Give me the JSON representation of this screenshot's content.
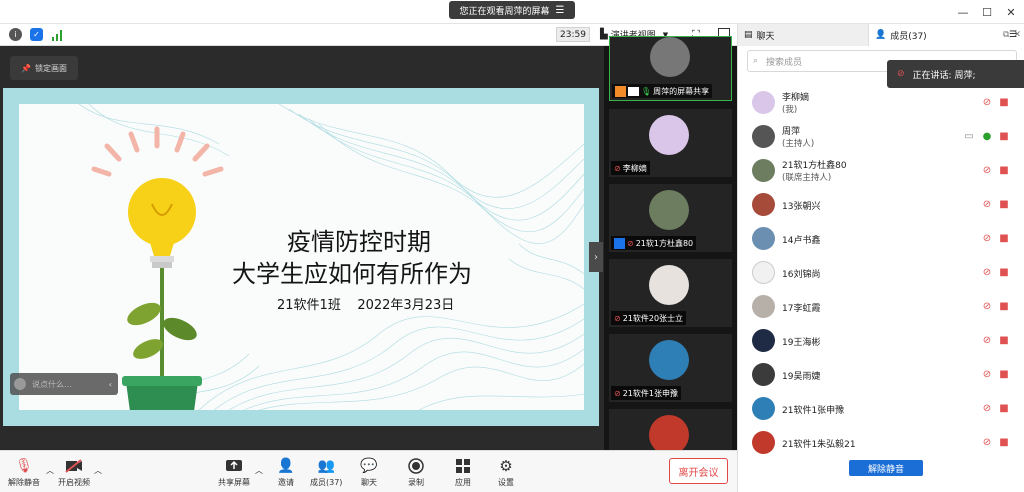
{
  "titlebar": {
    "viewing_banner": "您正在观看周萍的屏幕",
    "menu_icon": "hamburger-icon",
    "window_controls": [
      "minimize-icon",
      "maximize-icon",
      "close-icon"
    ]
  },
  "meetbar": {
    "timer": "23:59",
    "view_mode_label": "演讲者视图",
    "icons": [
      "info-icon",
      "shield-icon",
      "signal-icon",
      "fullscreen-icon",
      "sidebar-icon"
    ],
    "colors": {
      "info": "#555555",
      "shield": "#1a73e8",
      "signal": "#2ca02c"
    }
  },
  "stage": {
    "lock_label": "锁定画面",
    "slide": {
      "title_line1": "疫情防控时期",
      "title_line2": "大学生应如何有所作为",
      "meta": "21软件1班    2022年3月23日",
      "frame_color": "#a9dde1"
    },
    "comment_placeholder": "说点什么..."
  },
  "strip": {
    "tiles": [
      {
        "label": "周萍的屏幕共享",
        "avatar_color": "#777777",
        "active": true
      },
      {
        "label": "李柳嫡",
        "avatar_color": "#d9c6e9"
      },
      {
        "label": "21软1方杜鑫80",
        "avatar_color": "#6d7d5f"
      },
      {
        "label": "21软件20张士立",
        "avatar_color": "#e8e2de"
      },
      {
        "label": "21软件1张申豫",
        "avatar_color": "#2f7fb7"
      },
      {
        "label": "",
        "avatar_color": "#c0392b"
      }
    ]
  },
  "bottombar": {
    "unmute_label": "解除静音",
    "video_label": "开启视频",
    "share_label": "共享屏幕",
    "invite_label": "邀请",
    "members_label": "成员(37)",
    "chat_label": "聊天",
    "record_label": "录制",
    "apps_label": "应用",
    "settings_label": "设置",
    "leave_label": "离开会议"
  },
  "panel": {
    "chat_tab": "聊天",
    "members_tab": "成员(37)",
    "search_placeholder": "搜索成员",
    "speaking_prefix": "正在讲话: 周萍;",
    "unmute_all": "解除静音",
    "members": [
      {
        "name": "李柳嫡",
        "sub": "(我)",
        "avatar_color": "#d9c6e9"
      },
      {
        "name": "周萍",
        "sub": "(主持人)",
        "avatar_color": "#555555",
        "host": true
      },
      {
        "name": "21软1方杜鑫80",
        "sub": "(联席主持人)",
        "avatar_color": "#6d7d5f"
      },
      {
        "name": "13张朝兴",
        "sub": "",
        "avatar_color": "#a64a3a"
      },
      {
        "name": "14卢书鑫",
        "sub": "",
        "avatar_color": "#6a8fb0"
      },
      {
        "name": "16刘锦尚",
        "sub": "",
        "avatar_color": "#f1f1f1"
      },
      {
        "name": "17李虹霞",
        "sub": "",
        "avatar_color": "#b7b0a8"
      },
      {
        "name": "19王海彬",
        "sub": "",
        "avatar_color": "#1f2a44"
      },
      {
        "name": "19吴雨婕",
        "sub": "",
        "avatar_color": "#3b3b3b"
      },
      {
        "name": "21软件1张申豫",
        "sub": "",
        "avatar_color": "#2f7fb7"
      },
      {
        "name": "21软件1朱弘毅21",
        "sub": "",
        "avatar_color": "#c0392b"
      }
    ],
    "colors": {
      "muted_mic": "#e05252",
      "video_off": "#e05252",
      "speaking_mic": "#2ca02c"
    }
  }
}
